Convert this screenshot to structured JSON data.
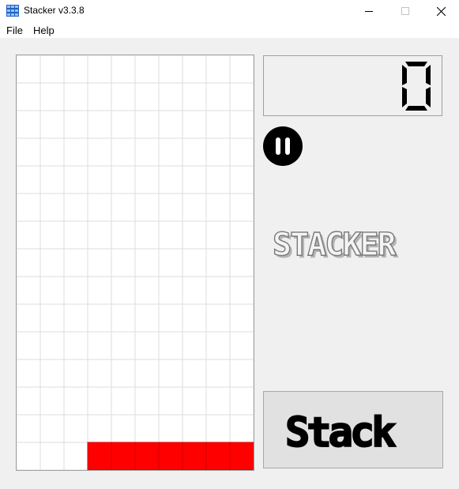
{
  "window": {
    "title": "Stacker v3.3.8",
    "controls": [
      "minimize",
      "maximize",
      "close"
    ]
  },
  "menu": {
    "items": [
      "File",
      "Help"
    ]
  },
  "board": {
    "columns": 10,
    "rows": 15,
    "cell_color": "#ffffff",
    "grid_color": "#dcdcdc",
    "block_color": "#ff0000",
    "filled": [
      {
        "row": 14,
        "cols": [
          3,
          4,
          5,
          6,
          7,
          8,
          9
        ]
      }
    ]
  },
  "score": {
    "value": "0"
  },
  "pause_button": {
    "icon": "pause-icon"
  },
  "logo": {
    "text": "STACKER"
  },
  "stack_button": {
    "label": "Stack"
  }
}
